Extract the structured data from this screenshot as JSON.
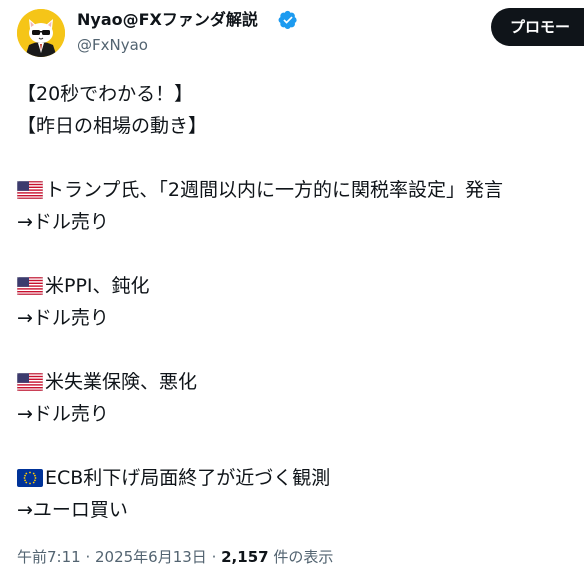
{
  "author": {
    "display_name": "Nyao@FXファンダ解説",
    "handle": "@FxNyao",
    "avatar_icon": "cat-in-suit-avatar",
    "verified_icon": "verified-badge-icon",
    "verified_color": "#1d9bf0"
  },
  "promo_button": {
    "label": "プロモー"
  },
  "tweet": {
    "headline_1": "【20秒でわかる！】",
    "headline_2": "【昨日の相場の動き】",
    "items": [
      {
        "flag": "us-flag-icon",
        "text": "トランプ氏、「2週間以内に一方的に関税率設定」発言",
        "result": "→ドル売り"
      },
      {
        "flag": "us-flag-icon",
        "text": "米PPI、鈍化",
        "result": "→ドル売り"
      },
      {
        "flag": "us-flag-icon",
        "text": "米失業保険、悪化",
        "result": "→ドル売り"
      },
      {
        "flag": "eu-flag-icon",
        "text": "ECB利下げ局面終了が近づく観測",
        "result": "→ユーロ買い"
      }
    ]
  },
  "meta": {
    "time": "午前7:11",
    "separator": " · ",
    "date": "2025年6月13日",
    "views_count": "2,157",
    "views_label": " 件の表示"
  },
  "colors": {
    "text": "#0f1419",
    "secondary": "#536471",
    "button_bg": "#0f1419",
    "avatar_bg": "#f5c518"
  }
}
